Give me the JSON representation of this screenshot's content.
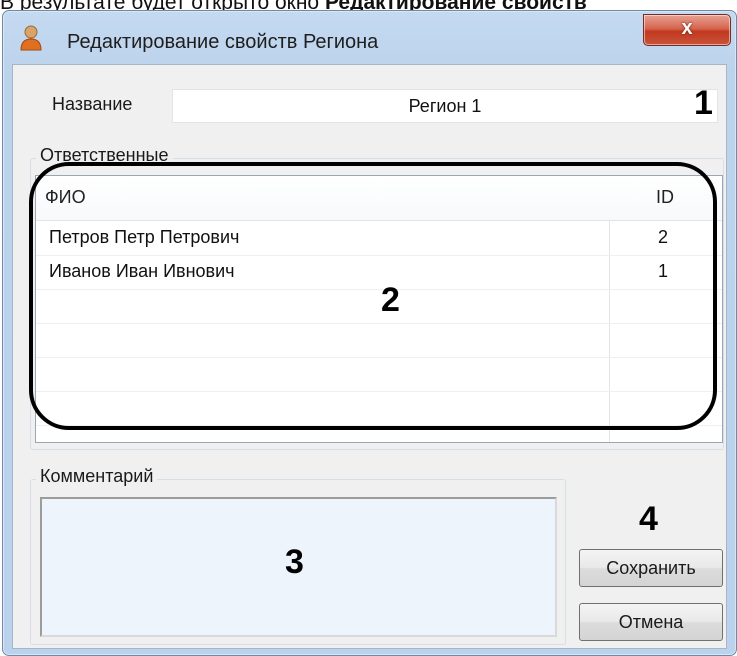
{
  "doc_fragment": {
    "prefix": "В результате будет открыто окно ",
    "bold": "Редактирование свойств"
  },
  "window": {
    "title": "Редактирование свойств Региона",
    "close_symbol": "x"
  },
  "form": {
    "name_label": "Название",
    "name_value": "Регион 1",
    "responsible_group": "Ответственные",
    "columns": [
      "ФИО",
      "ID"
    ],
    "rows": [
      {
        "name": "Петров Петр Петрович",
        "id": "2"
      },
      {
        "name": "Иванов Иван Ивнович",
        "id": "1"
      }
    ],
    "comment_group": "Комментарий",
    "comment_value": "",
    "save_label": "Сохранить",
    "cancel_label": "Отмена"
  },
  "annotations": {
    "n1": "1",
    "n2": "2",
    "n3": "3",
    "n4": "4"
  },
  "icons": {
    "title_icon": "user-icon",
    "close_icon": "close-icon"
  },
  "colors": {
    "window_frame": "#bad2ec",
    "close_button": "#c2391f",
    "client_bg": "#f0f0f0"
  }
}
